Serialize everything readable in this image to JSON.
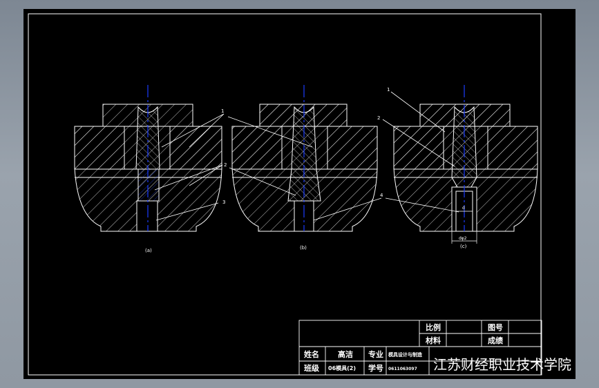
{
  "drawing": {
    "labels": {
      "a": "(a)",
      "b": "(b)",
      "c": "(c)",
      "callout_1": "1",
      "callout_2": "2",
      "callout_3": "3",
      "callout_4": "4",
      "dim_d": "d",
      "dim_d2": "dφ2"
    }
  },
  "title_block": {
    "scale_label": "比例",
    "drawing_no_label": "图号",
    "material_label": "材料",
    "grade_label": "成绩",
    "name_label": "姓名",
    "name_value": "高洁",
    "major_label": "专业",
    "major_value": "模具设计与制造",
    "class_label": "班级",
    "class_value": "06模具(2)",
    "student_no_label": "学号",
    "student_no_value": "0611063097",
    "school": "江苏财经职业技术学院"
  },
  "colors": {
    "viewport_bg": "#000000",
    "line": "#ffffff",
    "centerline": "#1a3cff"
  }
}
